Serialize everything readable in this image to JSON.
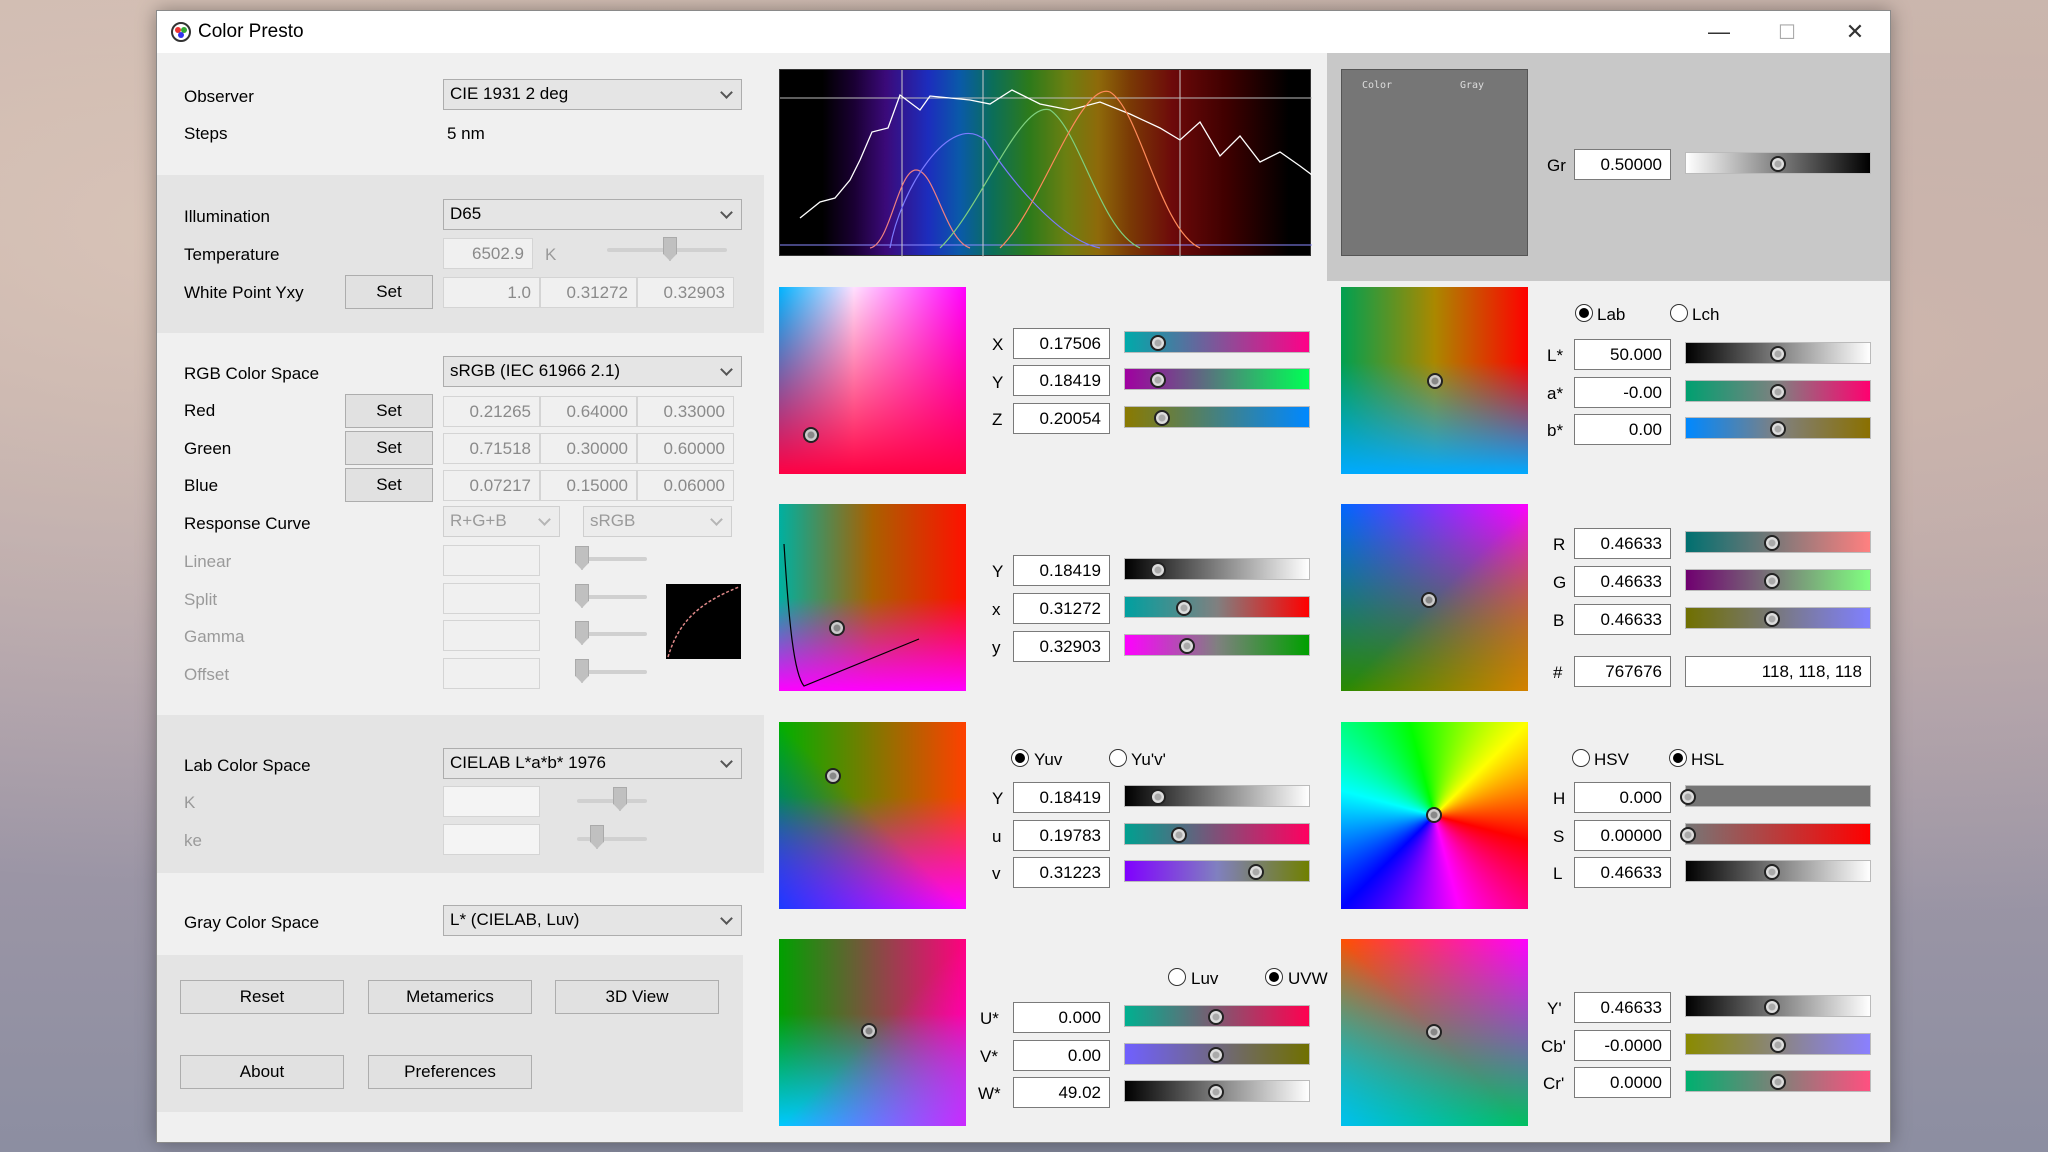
{
  "app": {
    "title": "Color Presto"
  },
  "window_controls": {
    "minimize": "—",
    "maximize": "☐",
    "close": "✕"
  },
  "left": {
    "observer": {
      "label": "Observer",
      "value": "CIE 1931 2 deg"
    },
    "steps": {
      "label": "Steps",
      "value": "5 nm"
    },
    "illumination": {
      "label": "Illumination",
      "value": "D65"
    },
    "temperature": {
      "label": "Temperature",
      "value": "6502.9",
      "unit": "K"
    },
    "white_point": {
      "label": "White Point Yxy",
      "set": "Set",
      "values": [
        "1.0",
        "0.31272",
        "0.32903"
      ]
    },
    "rgb_space": {
      "label": "RGB Color Space",
      "value": "sRGB (IEC 61966 2.1)"
    },
    "red": {
      "label": "Red",
      "set": "Set",
      "values": [
        "0.21265",
        "0.64000",
        "0.33000"
      ]
    },
    "green": {
      "label": "Green",
      "set": "Set",
      "values": [
        "0.71518",
        "0.30000",
        "0.60000"
      ]
    },
    "blue": {
      "label": "Blue",
      "set": "Set",
      "values": [
        "0.07217",
        "0.15000",
        "0.06000"
      ]
    },
    "response_curve": {
      "label": "Response Curve",
      "channel": "R+G+B",
      "curve": "sRGB"
    },
    "curve_params": [
      "Linear",
      "Split",
      "Gamma",
      "Offset"
    ],
    "lab_space": {
      "label": "Lab Color Space",
      "value": "CIELAB L*a*b* 1976"
    },
    "lab_params": [
      "K",
      "ke"
    ],
    "gray_space": {
      "label": "Gray Color Space",
      "value": "L* (CIELAB, Luv)"
    },
    "buttons": {
      "reset": "Reset",
      "metamerics": "Metamerics",
      "view3d": "3D View",
      "about": "About",
      "preferences": "Preferences"
    }
  },
  "preview": {
    "color_label": "Color",
    "gray_label": "Gray",
    "gr_label": "Gr",
    "gr_value": "0.50000"
  },
  "xyz": {
    "labels": [
      "X",
      "Y",
      "Z"
    ],
    "values": [
      "0.17506",
      "0.18419",
      "0.20054"
    ]
  },
  "lab": {
    "radio_lab": "Lab",
    "radio_lch": "Lch",
    "labels": [
      "L*",
      "a*",
      "b*"
    ],
    "values": [
      "50.000",
      "-0.00",
      "0.00"
    ]
  },
  "yxy": {
    "labels": [
      "Y",
      "x",
      "y"
    ],
    "values": [
      "0.18419",
      "0.31272",
      "0.32903"
    ]
  },
  "rgb": {
    "labels": [
      "R",
      "G",
      "B"
    ],
    "values": [
      "0.46633",
      "0.46633",
      "0.46633"
    ],
    "hex_label": "#",
    "hex": "767676",
    "triplet": "118, 118, 118"
  },
  "yuv": {
    "radio_yuv": "Yuv",
    "radio_yupvp": "Yu'v'",
    "labels": [
      "Y",
      "u",
      "v"
    ],
    "values": [
      "0.18419",
      "0.19783",
      "0.31223"
    ]
  },
  "hsl": {
    "radio_hsv": "HSV",
    "radio_hsl": "HSL",
    "labels": [
      "H",
      "S",
      "L"
    ],
    "values": [
      "0.000",
      "0.00000",
      "0.46633"
    ]
  },
  "uvw": {
    "radio_luv": "Luv",
    "radio_uvw": "UVW",
    "labels": [
      "U*",
      "V*",
      "W*"
    ],
    "values": [
      "0.000",
      "0.00",
      "49.02"
    ]
  },
  "ycbcr": {
    "labels": [
      "Y'",
      "Cb'",
      "Cr'"
    ],
    "values": [
      "0.46633",
      "-0.0000",
      "0.0000"
    ]
  }
}
